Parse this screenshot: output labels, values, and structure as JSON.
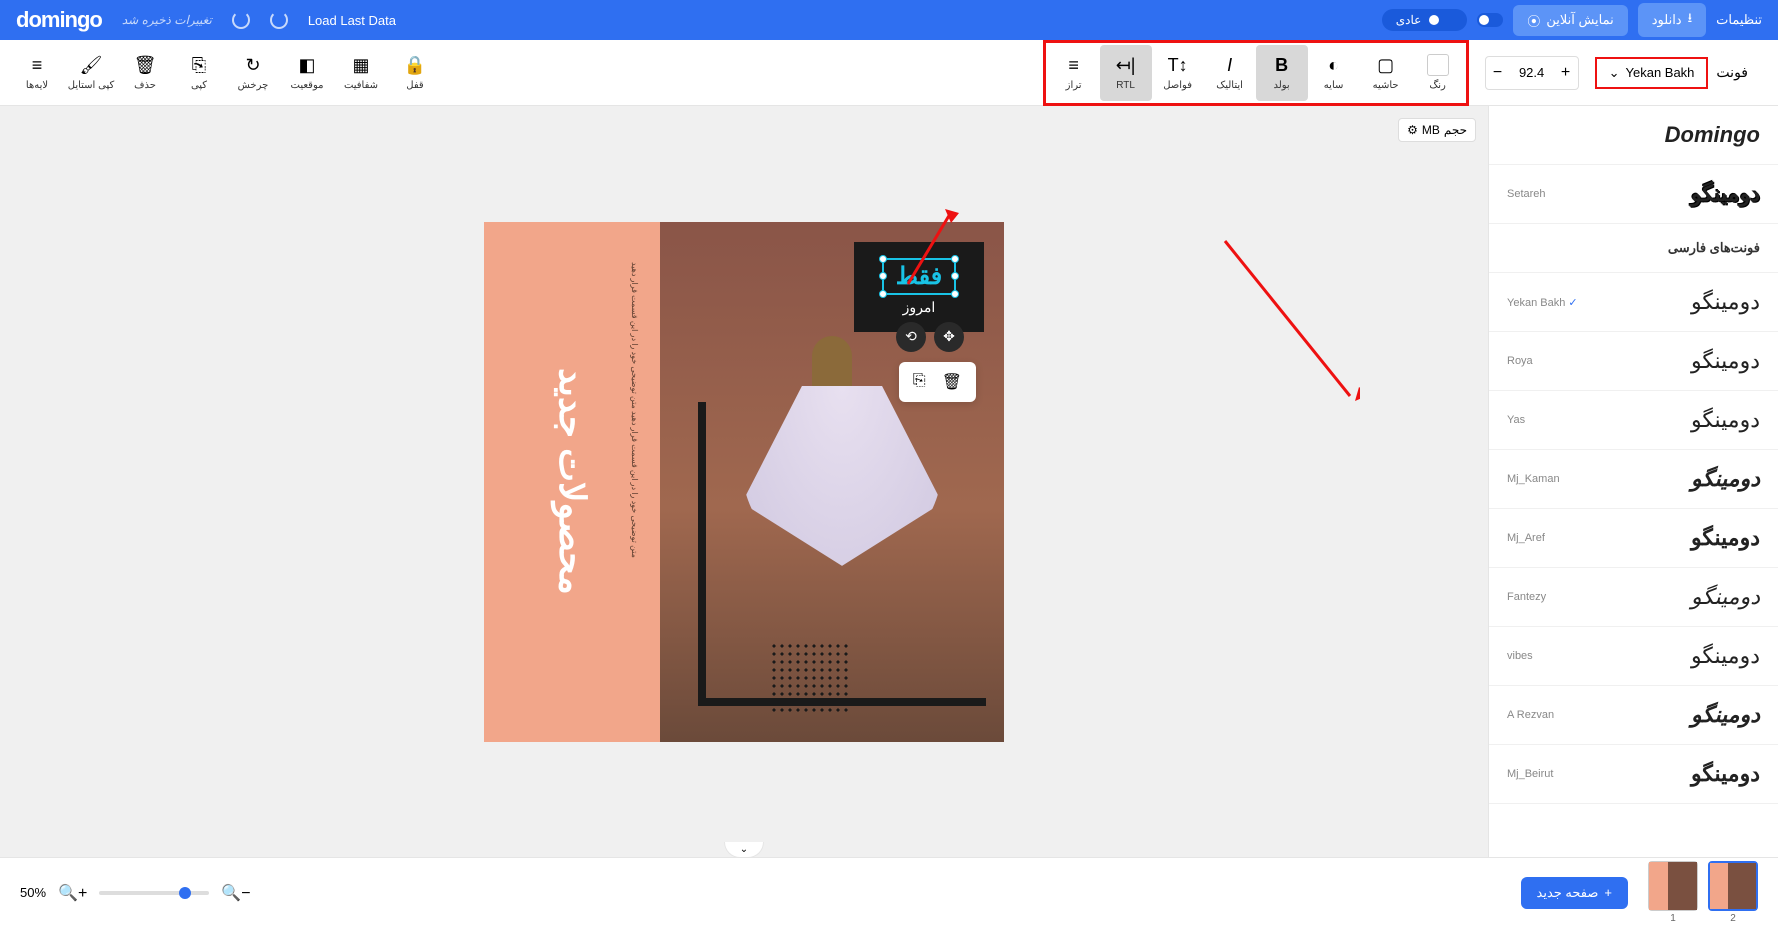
{
  "header": {
    "logo": "domingo",
    "saved_text": "تغییرات ذخیره شد",
    "load_last": "Load Last Data",
    "mode_label": "عادی",
    "preview_label": "نمایش آنلاین",
    "download_label": "دانلود",
    "settings_label": "تنظیمات"
  },
  "left_toolbar": {
    "layers": "لایه‌ها",
    "copy_style": "کپی استایل",
    "delete": "حذف",
    "copy": "کپی",
    "rotate": "چرخش",
    "position": "موقعیت",
    "opacity": "شفافیت",
    "lock": "قفل"
  },
  "text_toolbar": {
    "align": "تراز",
    "rtl": "RTL",
    "spacing": "فواصل",
    "italic": "ایتالیک",
    "bold": "بولد",
    "shadow": "سایه",
    "border": "حاشیه",
    "color": "رنگ"
  },
  "font_size": "92.4",
  "font_selected": "Yekan Bakh",
  "panel_title": "فونت",
  "size_badge": {
    "unit": "MB",
    "label": "حجم"
  },
  "canvas": {
    "left_title": "محصولات جدید",
    "left_desc": "متن توضیحی خود را در این قسمت قرار دهید متن توضیحی خود را در این قسمت قرار دهید",
    "sel_text": "فقط",
    "sub_text": "امروز"
  },
  "fonts_section_title": "فونت‌های فارسی",
  "fonts": [
    {
      "name": "",
      "preview": "Domingo",
      "style": "font-weight:900;font-style:italic"
    },
    {
      "name": "Setareh",
      "preview": "دومینگو",
      "style": "font-weight:900;text-shadow:1px 1px 0 #000,-1px -1px 0 #000"
    },
    {
      "name": "Yekan Bakh",
      "preview": "دومینگو",
      "style": "",
      "selected": true
    },
    {
      "name": "Roya",
      "preview": "دومینگو",
      "style": ""
    },
    {
      "name": "Yas",
      "preview": "دومینگو",
      "style": ""
    },
    {
      "name": "Mj_Kaman",
      "preview": "دومینگو",
      "style": "font-weight:900;font-style:italic"
    },
    {
      "name": "Mj_Aref",
      "preview": "دومینگو",
      "style": "font-weight:700"
    },
    {
      "name": "Fantezy",
      "preview": "دومینگو",
      "style": "font-family:cursive;font-style:italic"
    },
    {
      "name": "vibes",
      "preview": "دومینگو",
      "style": "font-family:cursive"
    },
    {
      "name": "A Rezvan",
      "preview": "دومینگو",
      "style": "font-style:italic;font-weight:700"
    },
    {
      "name": "Mj_Beirut",
      "preview": "دومینگو",
      "style": "font-weight:900"
    }
  ],
  "footer": {
    "zoom": "50%",
    "new_page": "صفحه جدید",
    "pages": [
      "1",
      "2"
    ]
  }
}
